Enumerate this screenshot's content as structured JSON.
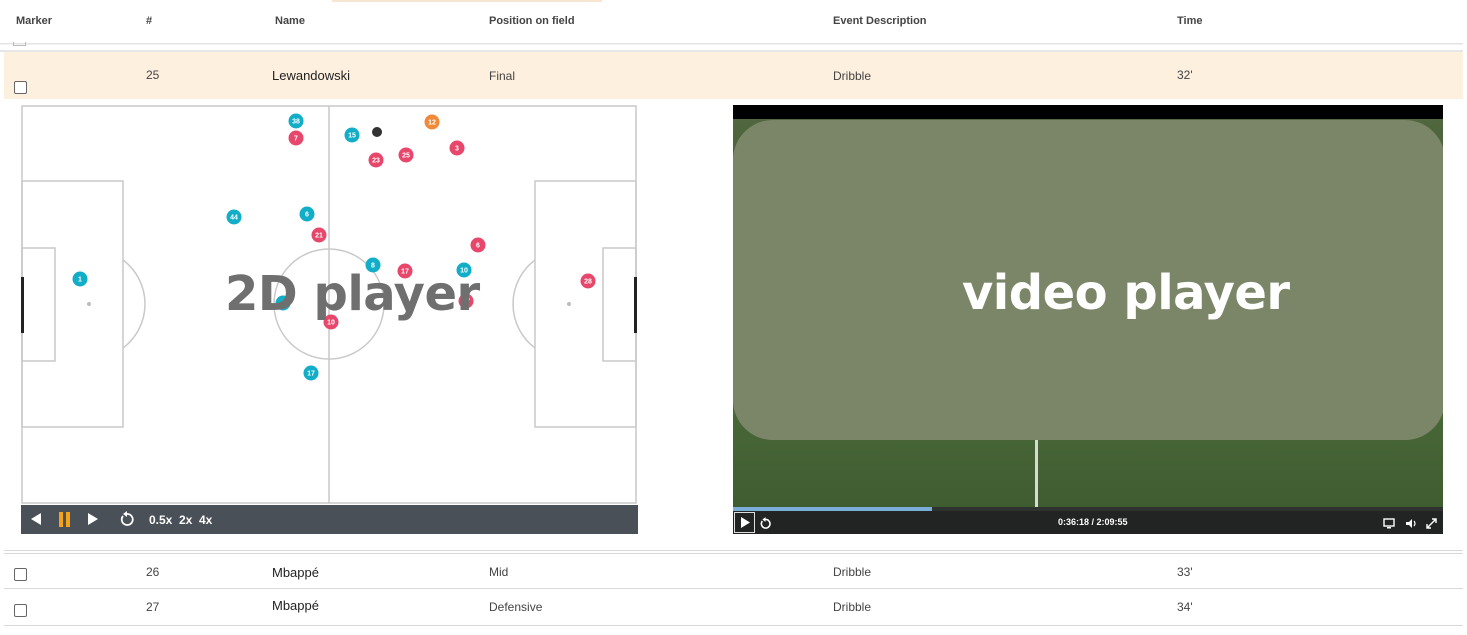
{
  "columns": {
    "marker": "Marker",
    "number": "#",
    "name": "Name",
    "position": "Position on field",
    "description": "Event Description",
    "time": "Time"
  },
  "rows": [
    {
      "number": "25",
      "name": "Lewandowski",
      "position": "Final",
      "description": "Dribble",
      "time": "32'",
      "selected": true
    },
    {
      "number": "26",
      "name": "Mbappé",
      "position": "Mid",
      "description": "Dribble",
      "time": "33'",
      "selected": false
    },
    {
      "number": "27",
      "name": "Mbappé",
      "position": "Defensive",
      "description": "Dribble",
      "time": "34'",
      "selected": false
    }
  ],
  "player2d": {
    "overlay_label": "2D player",
    "speeds": [
      "0.5x",
      "2x",
      "4x"
    ],
    "colors": {
      "team_a": "#e8476c",
      "team_b": "#12aec8",
      "highlight": "#f08a3a",
      "ball": "#333333",
      "control_bar": "#4a5057",
      "pause": "#f5a31a"
    },
    "players": [
      {
        "label": "38",
        "team": "b"
      },
      {
        "label": "7",
        "team": "a"
      },
      {
        "label": "15",
        "team": "b"
      },
      {
        "label": "12",
        "team": "h"
      },
      {
        "label": "23",
        "team": "a"
      },
      {
        "label": "25",
        "team": "a"
      },
      {
        "label": "3",
        "team": "a"
      },
      {
        "label": "44",
        "team": "b"
      },
      {
        "label": "6",
        "team": "b"
      },
      {
        "label": "21",
        "team": "a"
      },
      {
        "label": "6",
        "team": "a"
      },
      {
        "label": "1",
        "team": "b"
      },
      {
        "label": "8",
        "team": "b"
      },
      {
        "label": "17",
        "team": "a"
      },
      {
        "label": "10",
        "team": "b"
      },
      {
        "label": "28",
        "team": "a"
      },
      {
        "label": "4",
        "team": "b"
      },
      {
        "label": "10",
        "team": "a"
      },
      {
        "label": "27",
        "team": "a"
      },
      {
        "label": "17",
        "team": "b"
      }
    ]
  },
  "video": {
    "overlay_label": "video player",
    "time_display": "0:36:18 / 2:09:55",
    "progress": 0.28
  }
}
